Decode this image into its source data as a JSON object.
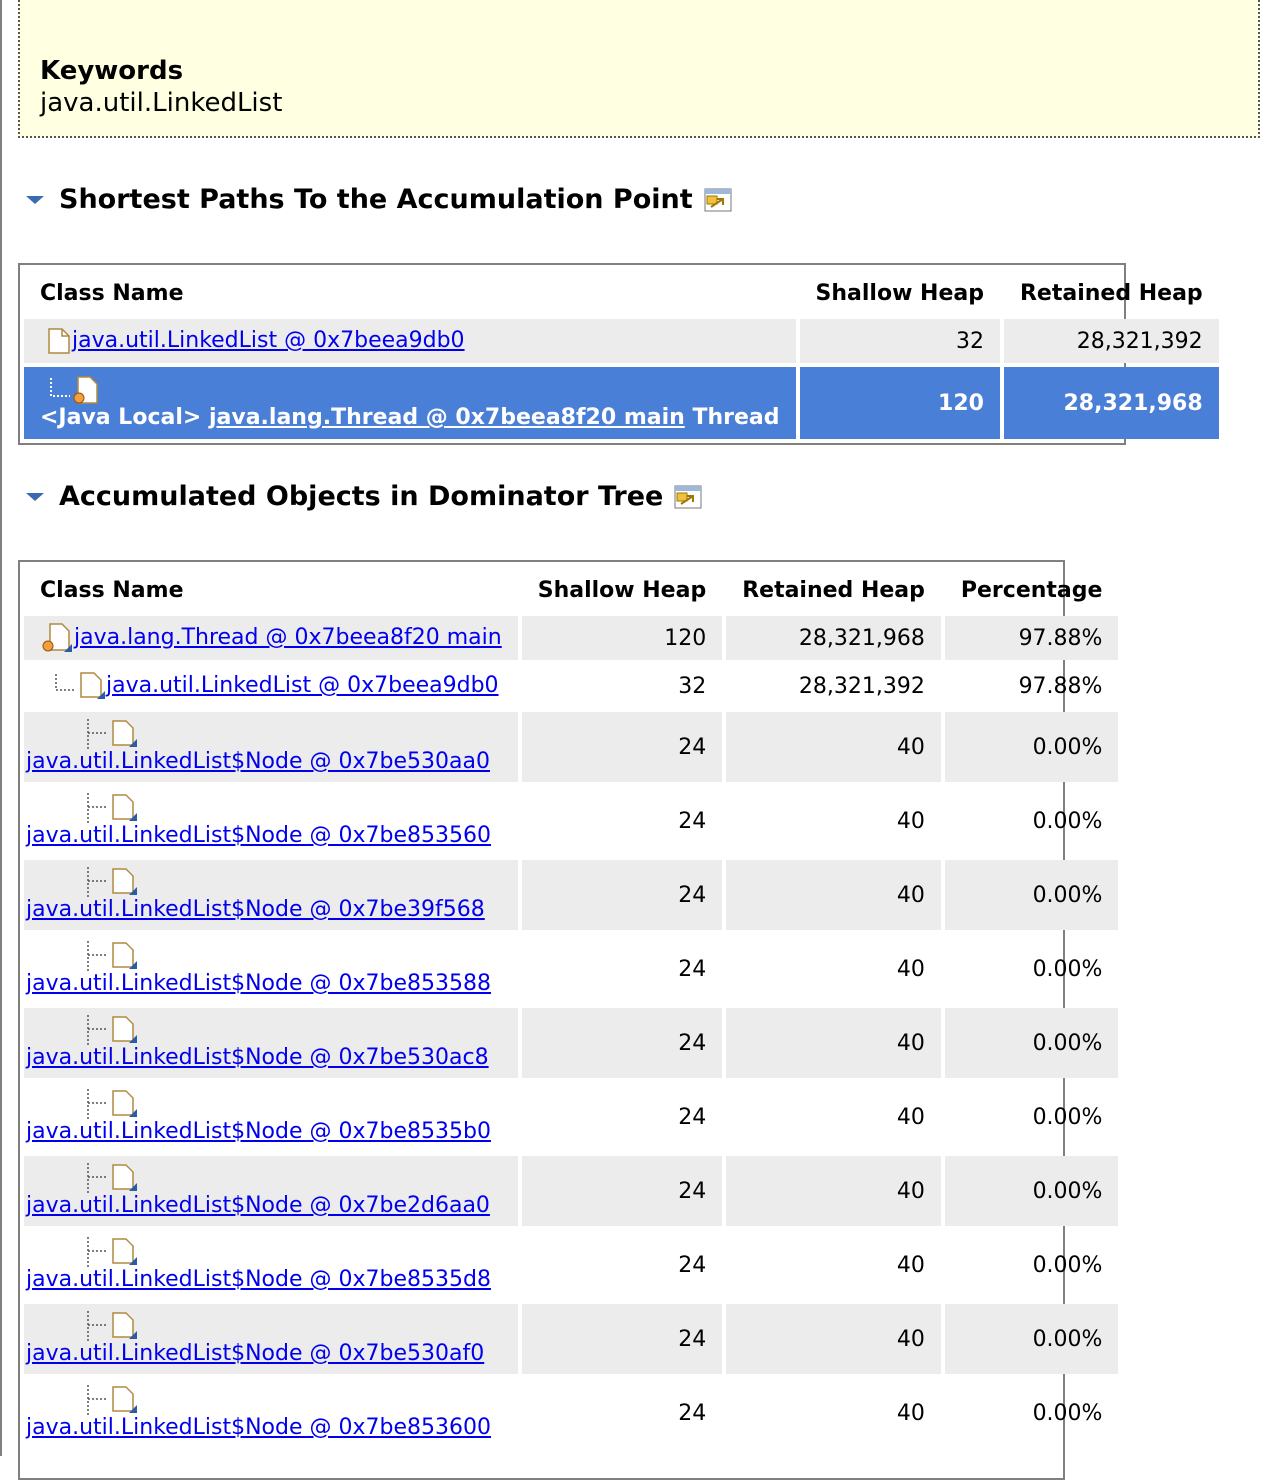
{
  "keywords": {
    "title": "Keywords",
    "value": "java.util.LinkedList"
  },
  "section1": {
    "title": "Shortest Paths To the Accumulation Point",
    "columns": [
      "Class Name",
      "Shallow Heap",
      "Retained Heap"
    ],
    "rows": [
      {
        "link": "java.util.LinkedList @ 0x7beea9db0",
        "shallow": "32",
        "retained": "28,321,392"
      },
      {
        "prefix": "<Java Local>",
        "link": "java.lang.Thread @ 0x7beea8f20 main",
        "suffix": "Thread",
        "shallow": "120",
        "retained": "28,321,968"
      }
    ]
  },
  "section2": {
    "title": "Accumulated Objects in Dominator Tree",
    "columns": [
      "Class Name",
      "Shallow Heap",
      "Retained Heap",
      "Percentage"
    ],
    "rows": [
      {
        "link": "java.lang.Thread @ 0x7beea8f20 main",
        "shallow": "120",
        "retained": "28,321,968",
        "pct": "97.88%"
      },
      {
        "link": "java.util.LinkedList @ 0x7beea9db0",
        "shallow": "32",
        "retained": "28,321,392",
        "pct": "97.88%"
      },
      {
        "link": "java.util.LinkedList$Node @ 0x7be530aa0",
        "shallow": "24",
        "retained": "40",
        "pct": "0.00%"
      },
      {
        "link": "java.util.LinkedList$Node @ 0x7be853560",
        "shallow": "24",
        "retained": "40",
        "pct": "0.00%"
      },
      {
        "link": "java.util.LinkedList$Node @ 0x7be39f568",
        "shallow": "24",
        "retained": "40",
        "pct": "0.00%"
      },
      {
        "link": "java.util.LinkedList$Node @ 0x7be853588",
        "shallow": "24",
        "retained": "40",
        "pct": "0.00%"
      },
      {
        "link": "java.util.LinkedList$Node @ 0x7be530ac8",
        "shallow": "24",
        "retained": "40",
        "pct": "0.00%"
      },
      {
        "link": "java.util.LinkedList$Node @ 0x7be8535b0",
        "shallow": "24",
        "retained": "40",
        "pct": "0.00%"
      },
      {
        "link": "java.util.LinkedList$Node @ 0x7be2d6aa0",
        "shallow": "24",
        "retained": "40",
        "pct": "0.00%"
      },
      {
        "link": "java.util.LinkedList$Node @ 0x7be8535d8",
        "shallow": "24",
        "retained": "40",
        "pct": "0.00%"
      },
      {
        "link": "java.util.LinkedList$Node @ 0x7be530af0",
        "shallow": "24",
        "retained": "40",
        "pct": "0.00%"
      },
      {
        "link": "java.util.LinkedList$Node @ 0x7be853600",
        "shallow": "24",
        "retained": "40",
        "pct": "0.00%"
      }
    ]
  }
}
